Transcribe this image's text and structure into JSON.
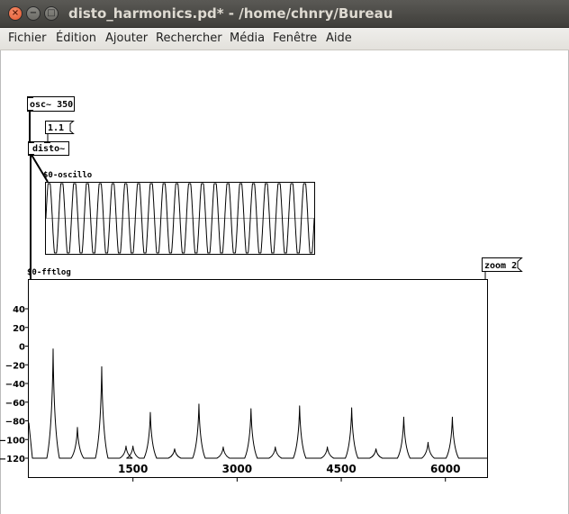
{
  "window": {
    "title": "disto_harmonics.pd* - /home/chnry/Bureau",
    "close_glyph": "×",
    "minimize_glyph": "−",
    "maximize_glyph": "□"
  },
  "menubar": {
    "items": [
      "Fichier",
      "Édition",
      "Ajouter",
      "Rechercher",
      "Média",
      "Fenêtre",
      "Aide"
    ]
  },
  "patch": {
    "osc_label": "osc~ 350",
    "msg_value": "1.1",
    "disto_label": "disto~",
    "oscillo_label": "$0-oscillo",
    "fft_label": "$0-fftlog",
    "zoom_label": "zoom 2"
  },
  "chart_data": {
    "type": "line",
    "title": "$0-fftlog",
    "xlabel": "",
    "ylabel": "",
    "xlim": [
      0,
      6600
    ],
    "ylim": [
      -120,
      50
    ],
    "y_ticks": [
      40,
      20,
      0,
      -20,
      -40,
      -60,
      -80,
      -100,
      -120
    ],
    "y_tick_labels": [
      "40",
      "20",
      "0",
      "−20",
      "−40",
      "−60",
      "−80",
      "−100",
      "−120"
    ],
    "x_ticks": [
      1500,
      3000,
      4500,
      6000
    ],
    "x_tick_labels": [
      "1500",
      "3000",
      "4500",
      "6000"
    ],
    "grid": false,
    "peaks": [
      {
        "x": 350,
        "y": -3
      },
      {
        "x": 700,
        "y": -87
      },
      {
        "x": 1050,
        "y": -22
      },
      {
        "x": 1400,
        "y": -107
      },
      {
        "x": 1500,
        "y": -107
      },
      {
        "x": 1750,
        "y": -71
      },
      {
        "x": 2100,
        "y": -110
      },
      {
        "x": 2450,
        "y": -62
      },
      {
        "x": 2800,
        "y": -108
      },
      {
        "x": 3200,
        "y": -67
      },
      {
        "x": 3550,
        "y": -108
      },
      {
        "x": 3900,
        "y": -64
      },
      {
        "x": 4300,
        "y": -108
      },
      {
        "x": 4650,
        "y": -66
      },
      {
        "x": 5000,
        "y": -110
      },
      {
        "x": 5400,
        "y": -76
      },
      {
        "x": 5750,
        "y": -103
      },
      {
        "x": 6100,
        "y": -76
      }
    ]
  }
}
